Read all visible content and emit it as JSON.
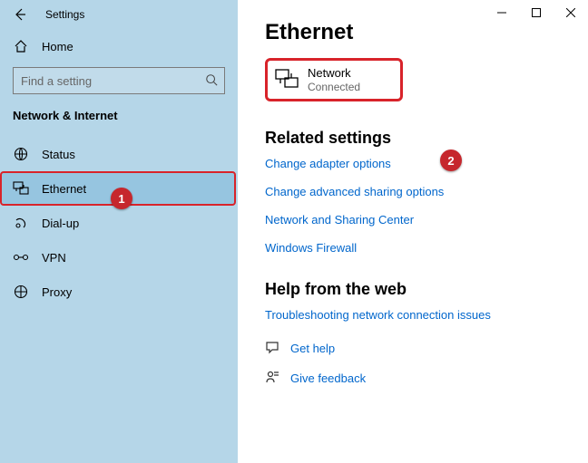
{
  "window": {
    "title": "Settings"
  },
  "sidebar": {
    "home": "Home",
    "search_placeholder": "Find a setting",
    "section": "Network & Internet",
    "items": [
      {
        "label": "Status"
      },
      {
        "label": "Ethernet"
      },
      {
        "label": "Dial-up"
      },
      {
        "label": "VPN"
      },
      {
        "label": "Proxy"
      }
    ]
  },
  "main": {
    "heading": "Ethernet",
    "network": {
      "name": "Network",
      "status": "Connected"
    },
    "related_heading": "Related settings",
    "related_links": [
      "Change adapter options",
      "Change advanced sharing options",
      "Network and Sharing Center",
      "Windows Firewall"
    ],
    "help_heading": "Help from the web",
    "help_link": "Troubleshooting network connection issues",
    "get_help": "Get help",
    "feedback": "Give feedback"
  },
  "callouts": {
    "one": "1",
    "two": "2"
  }
}
